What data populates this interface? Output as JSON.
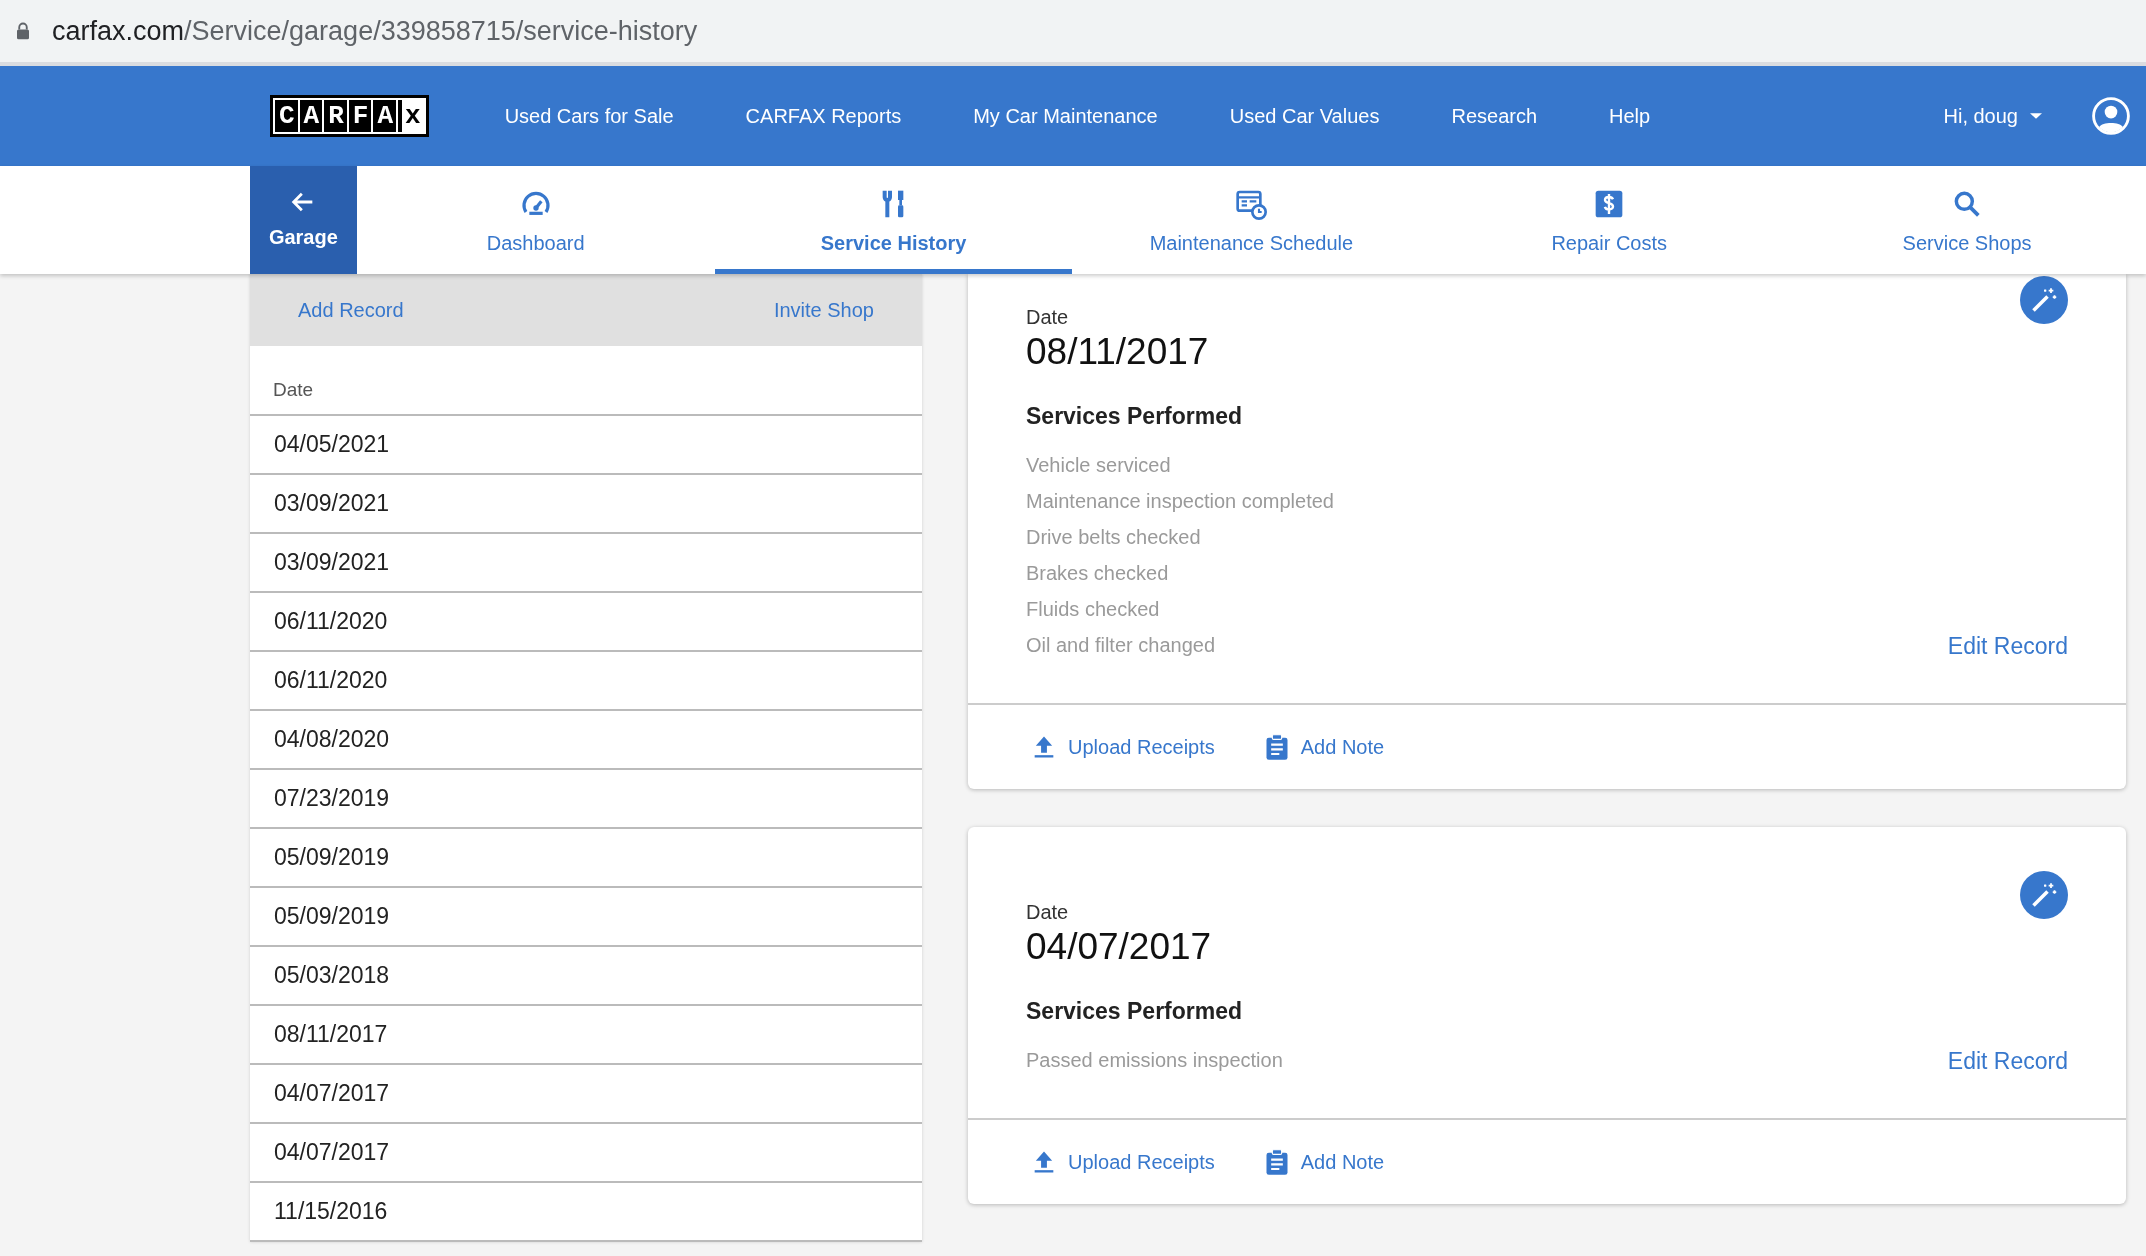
{
  "browser": {
    "url_host": "carfax.com",
    "url_path": "/Service/garage/339858715/service-history"
  },
  "logo": "CARFAx",
  "nav": {
    "links": [
      "Used Cars for Sale",
      "CARFAX Reports",
      "My Car Maintenance",
      "Used Car Values",
      "Research",
      "Help"
    ],
    "user": "Hi, doug"
  },
  "garage_button": {
    "label": "Garage"
  },
  "tabs": [
    {
      "label": "Dashboard",
      "selected": false
    },
    {
      "label": "Service History",
      "selected": true
    },
    {
      "label": "Maintenance Schedule",
      "selected": false
    },
    {
      "label": "Repair Costs",
      "selected": false
    },
    {
      "label": "Service Shops",
      "selected": false
    }
  ],
  "records_panel": {
    "actions": [
      "Add Record",
      "Invite Shop"
    ],
    "column": "Date",
    "rows": [
      "04/05/2021",
      "03/09/2021",
      "03/09/2021",
      "06/11/2020",
      "06/11/2020",
      "04/08/2020",
      "07/23/2019",
      "05/09/2019",
      "05/09/2019",
      "05/03/2018",
      "08/11/2017",
      "04/07/2017",
      "04/07/2017",
      "11/15/2016"
    ]
  },
  "records": [
    {
      "date_label": "Date",
      "date": "08/11/2017",
      "heading": "Services Performed",
      "services": [
        "Vehicle serviced",
        "Maintenance inspection completed",
        "Drive belts checked",
        "Brakes checked",
        "Fluids checked",
        "Oil and filter changed"
      ],
      "edit": "Edit Record",
      "actions": [
        "Upload Receipts",
        "Add Note"
      ]
    },
    {
      "date_label": "Date",
      "date": "04/07/2017",
      "heading": "Services Performed",
      "services": [
        "Passed emissions inspection"
      ],
      "edit": "Edit Record",
      "actions": [
        "Upload Receipts",
        "Add Note"
      ]
    }
  ]
}
